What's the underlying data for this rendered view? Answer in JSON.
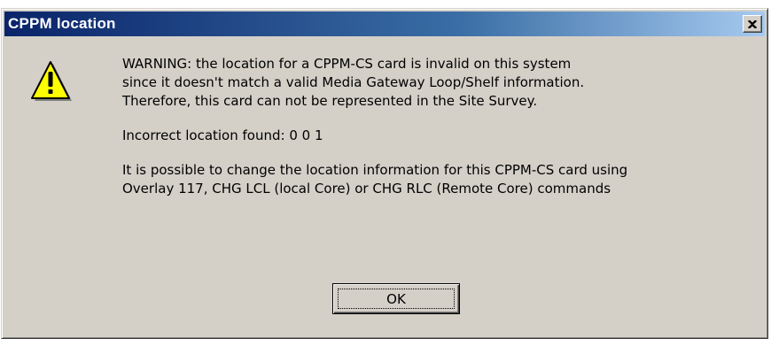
{
  "window": {
    "title": "CPPM location"
  },
  "icons": {
    "warning": "warning-triangle-icon",
    "close": "close-x-icon"
  },
  "colors": {
    "titlebar_start": "#0a246a",
    "titlebar_end": "#a6caf0",
    "dialog_face": "#d4d0c8",
    "warning_fill": "#ffff00"
  },
  "message": {
    "warning_text": "WARNING: the location for a CPPM-CS card is invalid on this system\nsince it doesn't match a valid Media Gateway Loop/Shelf information.\nTherefore, this card can not be represented in the Site Survey.",
    "location_text": "Incorrect location found: 0 0 1",
    "help_text": "It is possible to change the location information for this CPPM-CS card using\nOverlay 117, CHG LCL (local Core) or CHG RLC (Remote Core) commands"
  },
  "buttons": {
    "ok_label": "OK"
  }
}
